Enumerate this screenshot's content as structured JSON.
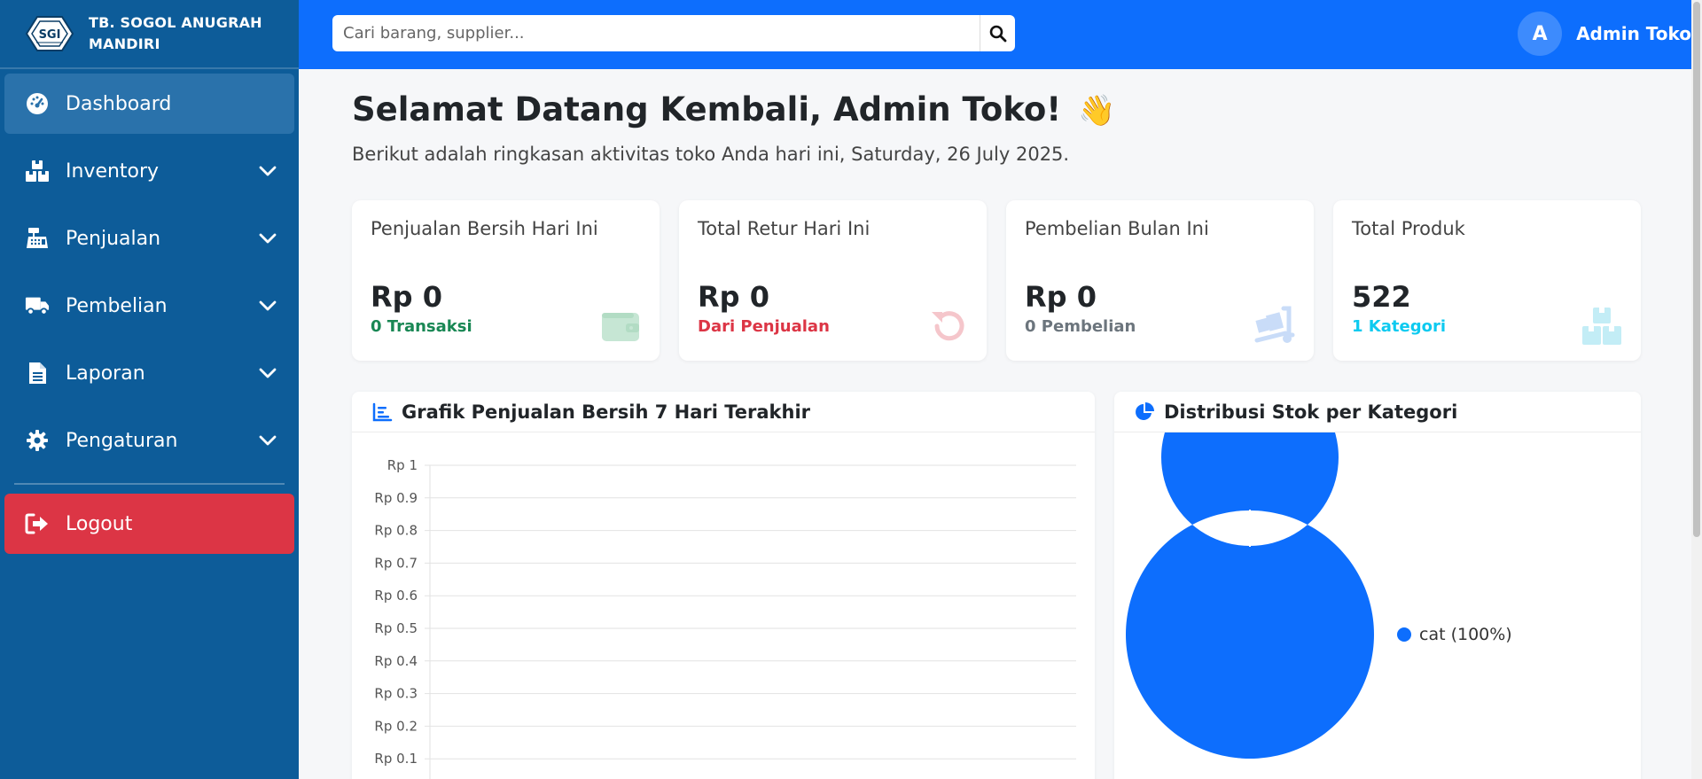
{
  "brand": {
    "line1": "TB. SOGOL ANUGRAH",
    "line2": "MANDIRI",
    "logo_text": "SGI"
  },
  "sidebar": {
    "items": [
      {
        "label": "Dashboard",
        "icon": "gauge-icon"
      },
      {
        "label": "Inventory",
        "icon": "boxes-icon"
      },
      {
        "label": "Penjualan",
        "icon": "cash-register-icon"
      },
      {
        "label": "Pembelian",
        "icon": "truck-icon"
      },
      {
        "label": "Laporan",
        "icon": "file-icon"
      },
      {
        "label": "Pengaturan",
        "icon": "gear-icon"
      }
    ],
    "logout": "Logout"
  },
  "topbar": {
    "search_placeholder": "Cari barang, supplier...",
    "user_initial": "A",
    "user_name": "Admin Toko"
  },
  "welcome": {
    "title": "Selamat Datang Kembali, Admin Toko!",
    "emoji": "👋",
    "subtitle": "Berikut adalah ringkasan aktivitas toko Anda hari ini, Saturday, 26 July 2025."
  },
  "stats": [
    {
      "label": "Penjualan Bersih Hari Ini",
      "value": "Rp 0",
      "sub": "0 Transaksi",
      "sub_color": "#198754",
      "icon": "wallet-icon"
    },
    {
      "label": "Total Retur Hari Ini",
      "value": "Rp 0",
      "sub": "Dari Penjualan",
      "sub_color": "#dc3545",
      "icon": "undo-icon"
    },
    {
      "label": "Pembelian Bulan Ini",
      "value": "Rp 0",
      "sub": "0 Pembelian",
      "sub_color": "#6c757d",
      "icon": "dolly-icon"
    },
    {
      "label": "Total Produk",
      "value": "522",
      "sub": "1 Kategori",
      "sub_color": "#0dcaf0",
      "icon": "boxes-icon"
    }
  ],
  "colors": {
    "sidebar": "#0d5c99",
    "topbar": "#0d6efd",
    "accent": "#0d6efd",
    "logout": "#dc3545"
  },
  "chart_data": [
    {
      "type": "line",
      "title": "Grafik Penjualan Bersih 7 Hari Terakhir",
      "y_ticks": [
        "Rp 1",
        "Rp 0.9",
        "Rp 0.8",
        "Rp 0.7",
        "Rp 0.6",
        "Rp 0.5",
        "Rp 0.4",
        "Rp 0.3",
        "Rp 0.2",
        "Rp 0.1"
      ],
      "ylim": [
        0,
        1
      ],
      "grid": true,
      "series": []
    },
    {
      "type": "pie",
      "title": "Distribusi Stok per Kategori",
      "labels": [
        "cat"
      ],
      "values": [
        100
      ],
      "legend": [
        "cat (100%)"
      ],
      "colors": [
        "#0d6efd"
      ],
      "legend_position": "right"
    }
  ]
}
